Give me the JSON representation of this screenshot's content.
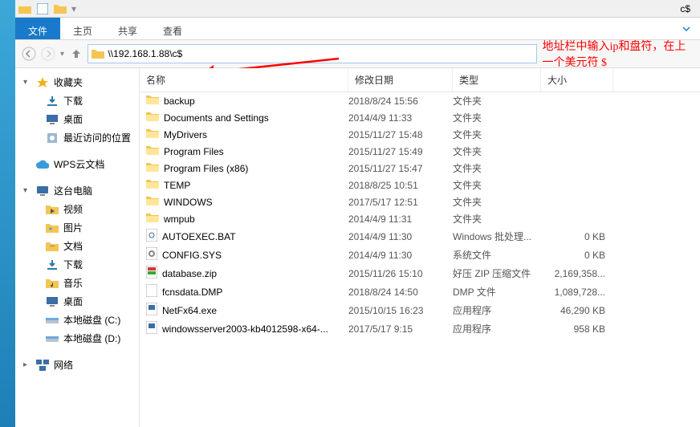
{
  "window_title": "c$",
  "address": "\\\\192.168.1.88\\c$",
  "annotation": "地址栏中输入ip和盘符，在上一个美元符 $",
  "ribbon": {
    "file": "文件",
    "home": "主页",
    "share": "共享",
    "view": "查看"
  },
  "columns": {
    "name": "名称",
    "date": "修改日期",
    "type": "类型",
    "size": "大小"
  },
  "sidebar": {
    "favorites": {
      "label": "收藏夹",
      "items": [
        {
          "label": "下载",
          "icon": "download"
        },
        {
          "label": "桌面",
          "icon": "desktop"
        },
        {
          "label": "最近访问的位置",
          "icon": "recent"
        }
      ]
    },
    "wps": {
      "label": "WPS云文档"
    },
    "thispc": {
      "label": "这台电脑",
      "items": [
        {
          "label": "视频",
          "icon": "video"
        },
        {
          "label": "图片",
          "icon": "pictures"
        },
        {
          "label": "文档",
          "icon": "documents"
        },
        {
          "label": "下载",
          "icon": "download"
        },
        {
          "label": "音乐",
          "icon": "music"
        },
        {
          "label": "桌面",
          "icon": "desktop"
        },
        {
          "label": "本地磁盘 (C:)",
          "icon": "drive"
        },
        {
          "label": "本地磁盘 (D:)",
          "icon": "drive"
        }
      ]
    },
    "network": {
      "label": "网络"
    }
  },
  "rows": [
    {
      "name": "backup",
      "date": "2018/8/24 15:56",
      "type": "文件夹",
      "size": "",
      "icon": "folder"
    },
    {
      "name": "Documents and Settings",
      "date": "2014/4/9 11:33",
      "type": "文件夹",
      "size": "",
      "icon": "folder"
    },
    {
      "name": "MyDrivers",
      "date": "2015/11/27 15:48",
      "type": "文件夹",
      "size": "",
      "icon": "folder"
    },
    {
      "name": "Program Files",
      "date": "2015/11/27 15:49",
      "type": "文件夹",
      "size": "",
      "icon": "folder"
    },
    {
      "name": "Program Files (x86)",
      "date": "2015/11/27 15:47",
      "type": "文件夹",
      "size": "",
      "icon": "folder"
    },
    {
      "name": "TEMP",
      "date": "2018/8/25 10:51",
      "type": "文件夹",
      "size": "",
      "icon": "folder"
    },
    {
      "name": "WINDOWS",
      "date": "2017/5/17 12:51",
      "type": "文件夹",
      "size": "",
      "icon": "folder"
    },
    {
      "name": "wmpub",
      "date": "2014/4/9 11:31",
      "type": "文件夹",
      "size": "",
      "icon": "folder"
    },
    {
      "name": "AUTOEXEC.BAT",
      "date": "2014/4/9 11:30",
      "type": "Windows 批处理...",
      "size": "0 KB",
      "icon": "bat"
    },
    {
      "name": "CONFIG.SYS",
      "date": "2014/4/9 11:30",
      "type": "系统文件",
      "size": "0 KB",
      "icon": "sys"
    },
    {
      "name": "database.zip",
      "date": "2015/11/26 15:10",
      "type": "好压 ZIP 压缩文件",
      "size": "2,169,358...",
      "icon": "zip"
    },
    {
      "name": "fcnsdata.DMP",
      "date": "2018/8/24 14:50",
      "type": "DMP 文件",
      "size": "1,089,728...",
      "icon": "file"
    },
    {
      "name": "NetFx64.exe",
      "date": "2015/10/15 16:23",
      "type": "应用程序",
      "size": "46,290 KB",
      "icon": "exe"
    },
    {
      "name": "windowsserver2003-kb4012598-x64-...",
      "date": "2017/5/17 9:15",
      "type": "应用程序",
      "size": "958 KB",
      "icon": "exe"
    }
  ]
}
